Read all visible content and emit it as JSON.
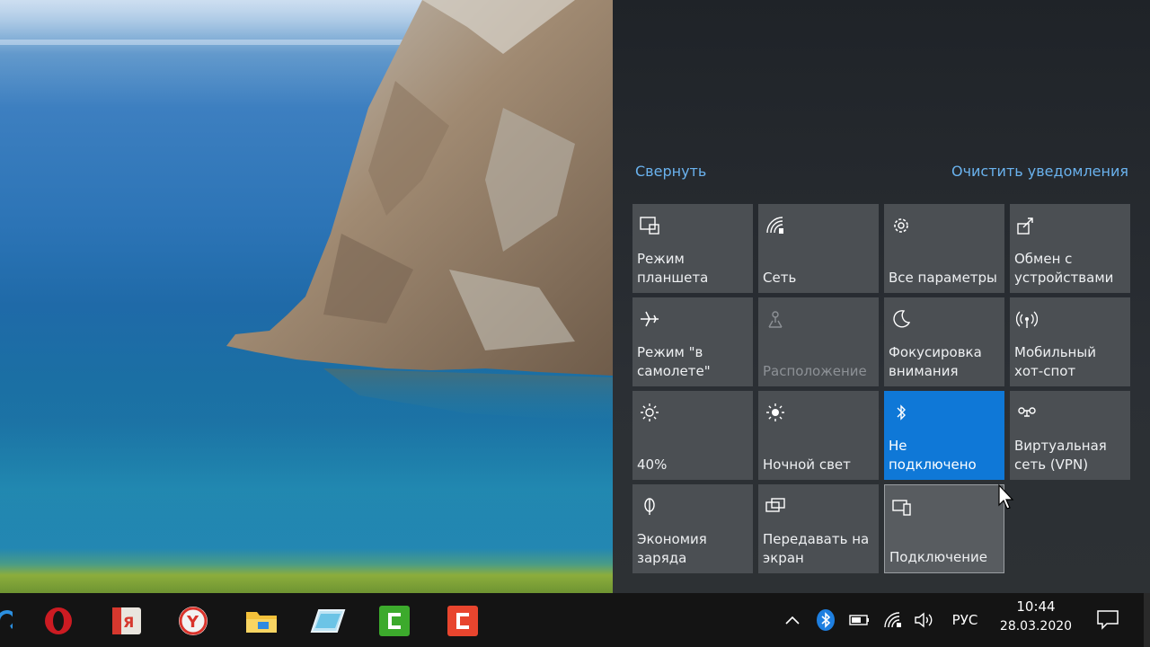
{
  "action_center": {
    "collapse_label": "Свернуть",
    "clear_label": "Очистить уведомления",
    "accent_color": "#0f78d7",
    "tiles": [
      {
        "label": "Режим\nпланшета",
        "icon": "tablet-mode-icon",
        "state": "off"
      },
      {
        "label": "Сеть",
        "icon": "network-icon",
        "state": "off"
      },
      {
        "label": "Все параметры",
        "icon": "settings-gear-icon",
        "state": "off"
      },
      {
        "label": "Обмен с\nустройствами",
        "icon": "nearby-sharing-icon",
        "state": "off"
      },
      {
        "label": "Режим \"в\nсамолете\"",
        "icon": "airplane-icon",
        "state": "off"
      },
      {
        "label": "Расположение",
        "icon": "location-icon",
        "state": "disabled"
      },
      {
        "label": "Фокусировка\nвнимания",
        "icon": "moon-icon",
        "state": "off"
      },
      {
        "label": "Мобильный\nхот-спот",
        "icon": "hotspot-icon",
        "state": "off"
      },
      {
        "label": "40%",
        "icon": "brightness-icon",
        "state": "off"
      },
      {
        "label": "Ночной свет",
        "icon": "night-light-icon",
        "state": "off"
      },
      {
        "label": "Не\nподключено",
        "icon": "bluetooth-icon",
        "state": "on"
      },
      {
        "label": "Виртуальная\nсеть (VPN)",
        "icon": "vpn-icon",
        "state": "off"
      },
      {
        "label": "Экономия\nзаряда",
        "icon": "battery-saver-icon",
        "state": "off"
      },
      {
        "label": "Передавать на\nэкран",
        "icon": "project-icon",
        "state": "off"
      },
      {
        "label": "Подключение",
        "icon": "connect-icon",
        "state": "hover"
      }
    ]
  },
  "taskbar": {
    "apps": [
      {
        "name": "opera-browser",
        "icon": "opera-icon"
      },
      {
        "name": "yandex-app",
        "icon": "yandex-icon"
      },
      {
        "name": "yandex-browser",
        "icon": "yandex-browser-icon"
      },
      {
        "name": "file-explorer",
        "icon": "folder-icon"
      },
      {
        "name": "app-5",
        "icon": "tablet-app-icon"
      },
      {
        "name": "camtasia-green",
        "icon": "camtasia-recorder-icon"
      },
      {
        "name": "camtasia-red",
        "icon": "camtasia-studio-icon"
      }
    ],
    "tray": {
      "language": "РУС",
      "time": "10:44",
      "date": "28.03.2020"
    }
  }
}
